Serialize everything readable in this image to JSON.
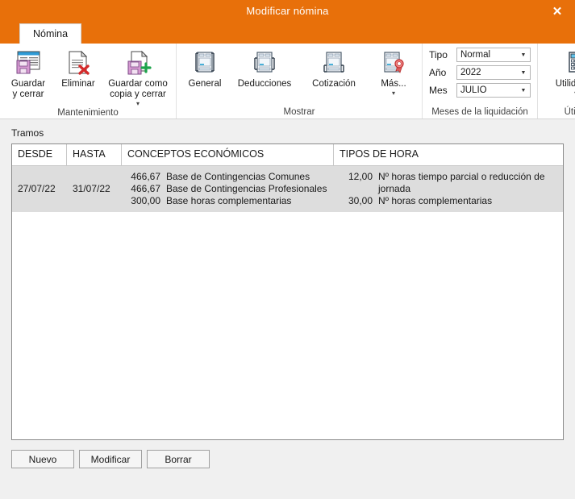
{
  "window": {
    "title": "Modificar nómina",
    "close_label": "✕"
  },
  "tabs": [
    {
      "label": "Nómina",
      "active": true
    }
  ],
  "ribbon": {
    "groups": [
      {
        "name": "mantenimiento",
        "label": "Mantenimiento",
        "buttons": [
          {
            "name": "guardar-y-cerrar",
            "label": "Guardar\ny cerrar",
            "icon": "save-window-icon",
            "caret": false
          },
          {
            "name": "eliminar",
            "label": "Eliminar",
            "icon": "document-delete-icon",
            "caret": false
          },
          {
            "name": "guardar-como-copia-y-cerrar",
            "label": "Guardar como\ncopia y cerrar",
            "icon": "save-copy-icon",
            "caret": true
          }
        ]
      },
      {
        "name": "mostrar",
        "label": "Mostrar",
        "buttons": [
          {
            "name": "general",
            "label": "General",
            "icon": "document-general-icon",
            "caret": false
          },
          {
            "name": "deducciones",
            "label": "Deducciones",
            "icon": "document-deducciones-icon",
            "caret": false
          },
          {
            "name": "cotizacion",
            "label": "Cotización",
            "icon": "document-cotizacion-icon",
            "caret": false
          },
          {
            "name": "mas",
            "label": "Más...",
            "icon": "document-seal-icon",
            "caret": true
          }
        ]
      },
      {
        "name": "meses-de-la-liquidacion",
        "label": "Meses de la liquidación",
        "combos": [
          {
            "name": "tipo",
            "label": "Tipo",
            "value": "Normal"
          },
          {
            "name": "ano",
            "label": "Año",
            "value": "2022"
          },
          {
            "name": "mes",
            "label": "Mes",
            "value": "JULIO"
          }
        ]
      },
      {
        "name": "utiles",
        "label": "Útiles",
        "buttons": [
          {
            "name": "utilidades",
            "label": "Utilidades",
            "icon": "calculator-icon",
            "caret": true
          }
        ]
      }
    ]
  },
  "main": {
    "section_label": "Tramos",
    "grid": {
      "columns": [
        {
          "key": "desde",
          "label": "DESDE"
        },
        {
          "key": "hasta",
          "label": "HASTA"
        },
        {
          "key": "conceptos",
          "label": "CONCEPTOS ECONÓMICOS"
        },
        {
          "key": "tipos",
          "label": "TIPOS DE HORA"
        }
      ],
      "rows": [
        {
          "selected": true,
          "desde": "27/07/22",
          "hasta": "31/07/22",
          "conceptos": [
            {
              "amount": "466,67",
              "text": "Base de Contingencias Comunes"
            },
            {
              "amount": "466,67",
              "text": "Base de Contingencias Profesionales"
            },
            {
              "amount": "300,00",
              "text": "Base horas complementarias"
            }
          ],
          "tipos": [
            {
              "amount": "12,00",
              "text": "Nº horas tiempo parcial o reducción de jornada"
            },
            {
              "amount": "30,00",
              "text": "Nº horas complementarias"
            }
          ]
        }
      ]
    }
  },
  "footer": {
    "buttons": [
      {
        "name": "nuevo",
        "label": "Nuevo"
      },
      {
        "name": "modificar",
        "label": "Modificar"
      },
      {
        "name": "borrar",
        "label": "Borrar"
      }
    ]
  },
  "colors": {
    "titlebar": "#e8700a",
    "selected_row": "#dddddd",
    "body_background": "#f0f0f0"
  }
}
